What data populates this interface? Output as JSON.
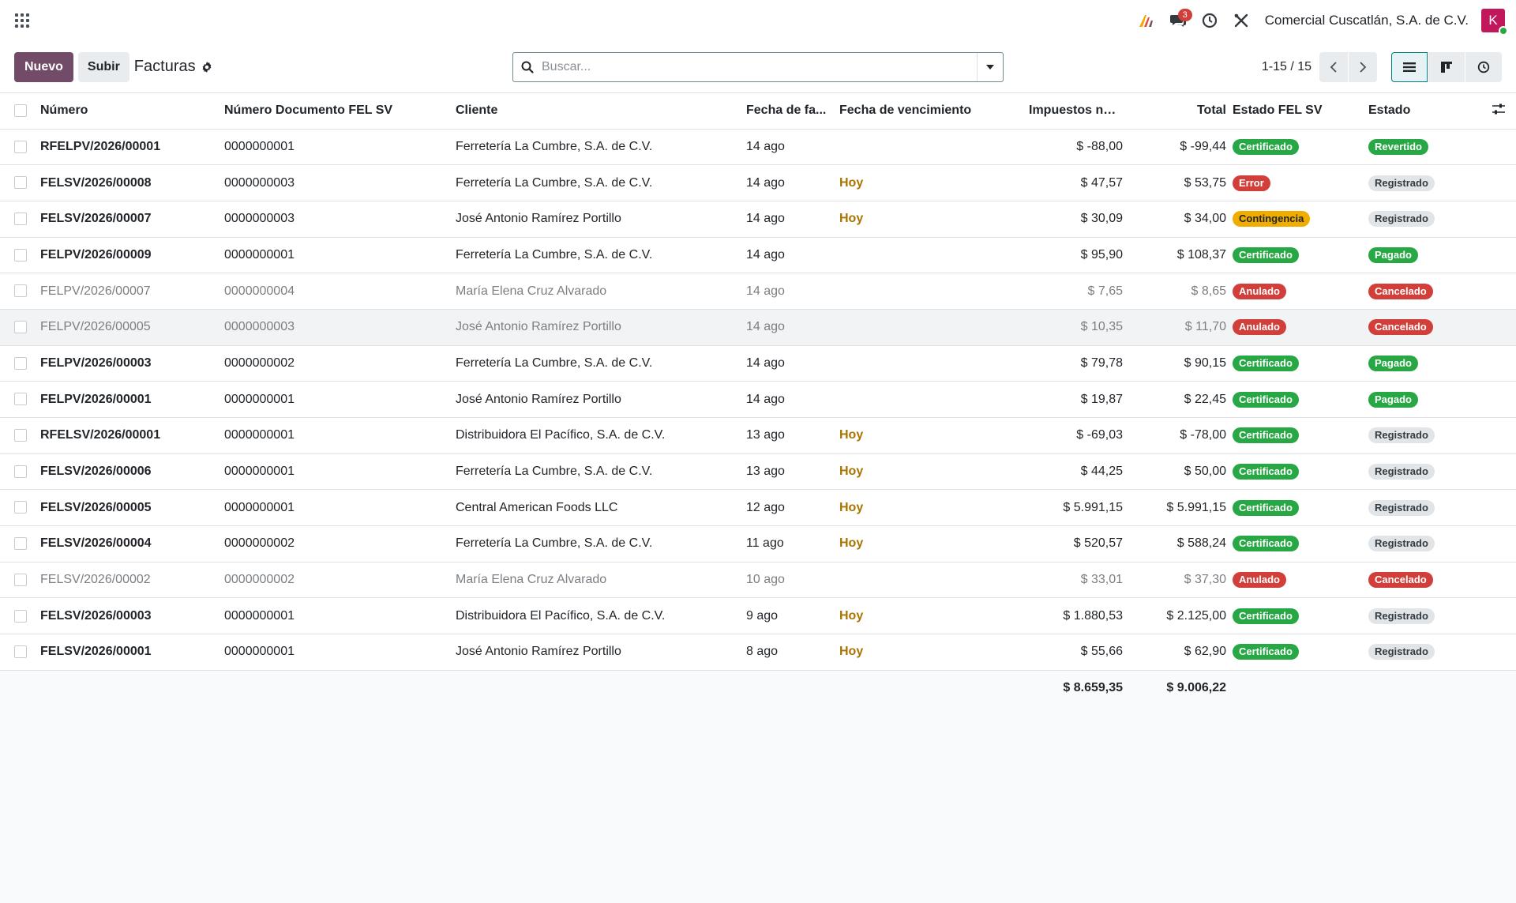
{
  "navbar": {
    "company": "Comercial Cuscatlán, S.A. de C.V.",
    "chat_count": "3",
    "avatar_letter": "K"
  },
  "control": {
    "new_label": "Nuevo",
    "upload_label": "Subir",
    "title": "Facturas",
    "search_placeholder": "Buscar...",
    "pager_value": "1-15 / 15"
  },
  "columns": {
    "numero": "Número",
    "doc_fel": "Número Documento FEL SV",
    "cliente": "Cliente",
    "fecha_factura": "Fecha de fa...",
    "fecha_vencimiento": "Fecha de vencimiento",
    "impuestos": "Impuestos no ...",
    "total": "Total",
    "estado_fel": "Estado FEL SV",
    "estado": "Estado"
  },
  "colors": {
    "brand": "#714b67",
    "accent": "#017e84",
    "badge_green": "#28a745",
    "badge_red": "#d23f3a",
    "badge_orange": "#f0ad00",
    "due_today": "#a97400"
  },
  "rows": [
    {
      "numero": "RFELPV/2026/00001",
      "doc": "0000000001",
      "cliente": "Ferretería La Cumbre, S.A. de C.V.",
      "fecha": "14 ago",
      "vence": "",
      "impuestos": "$ -88,00",
      "total": "$ -99,44",
      "fel": "Certificado",
      "fel_color": "green",
      "estado": "Revertido",
      "estado_color": "green",
      "muted": false
    },
    {
      "numero": "FELSV/2026/00008",
      "doc": "0000000003",
      "cliente": "Ferretería La Cumbre, S.A. de C.V.",
      "fecha": "14 ago",
      "vence": "Hoy",
      "impuestos": "$ 47,57",
      "total": "$ 53,75",
      "fel": "Error",
      "fel_color": "red",
      "estado": "Registrado",
      "estado_color": "grey",
      "muted": false
    },
    {
      "numero": "FELSV/2026/00007",
      "doc": "0000000003",
      "cliente": "José Antonio Ramírez Portillo",
      "fecha": "14 ago",
      "vence": "Hoy",
      "impuestos": "$ 30,09",
      "total": "$ 34,00",
      "fel": "Contingencia",
      "fel_color": "orange",
      "estado": "Registrado",
      "estado_color": "grey",
      "muted": false
    },
    {
      "numero": "FELPV/2026/00009",
      "doc": "0000000001",
      "cliente": "Ferretería La Cumbre, S.A. de C.V.",
      "fecha": "14 ago",
      "vence": "",
      "impuestos": "$ 95,90",
      "total": "$ 108,37",
      "fel": "Certificado",
      "fel_color": "green",
      "estado": "Pagado",
      "estado_color": "green",
      "muted": false
    },
    {
      "numero": "FELPV/2026/00007",
      "doc": "0000000004",
      "cliente": "María Elena Cruz Alvarado",
      "fecha": "14 ago",
      "vence": "",
      "impuestos": "$ 7,65",
      "total": "$ 8,65",
      "fel": "Anulado",
      "fel_color": "red",
      "estado": "Cancelado",
      "estado_color": "red",
      "muted": true
    },
    {
      "numero": "FELPV/2026/00005",
      "doc": "0000000003",
      "cliente": "José Antonio Ramírez Portillo",
      "fecha": "14 ago",
      "vence": "",
      "impuestos": "$ 10,35",
      "total": "$ 11,70",
      "fel": "Anulado",
      "fel_color": "red",
      "estado": "Cancelado",
      "estado_color": "red",
      "muted": true,
      "hover": true
    },
    {
      "numero": "FELPV/2026/00003",
      "doc": "0000000002",
      "cliente": "Ferretería La Cumbre, S.A. de C.V.",
      "fecha": "14 ago",
      "vence": "",
      "impuestos": "$ 79,78",
      "total": "$ 90,15",
      "fel": "Certificado",
      "fel_color": "green",
      "estado": "Pagado",
      "estado_color": "green",
      "muted": false
    },
    {
      "numero": "FELPV/2026/00001",
      "doc": "0000000001",
      "cliente": "José Antonio Ramírez Portillo",
      "fecha": "14 ago",
      "vence": "",
      "impuestos": "$ 19,87",
      "total": "$ 22,45",
      "fel": "Certificado",
      "fel_color": "green",
      "estado": "Pagado",
      "estado_color": "green",
      "muted": false
    },
    {
      "numero": "RFELSV/2026/00001",
      "doc": "0000000001",
      "cliente": "Distribuidora El Pacífico, S.A. de C.V.",
      "fecha": "13 ago",
      "vence": "Hoy",
      "impuestos": "$ -69,03",
      "total": "$ -78,00",
      "fel": "Certificado",
      "fel_color": "green",
      "estado": "Registrado",
      "estado_color": "grey",
      "muted": false
    },
    {
      "numero": "FELSV/2026/00006",
      "doc": "0000000001",
      "cliente": "Ferretería La Cumbre, S.A. de C.V.",
      "fecha": "13 ago",
      "vence": "Hoy",
      "impuestos": "$ 44,25",
      "total": "$ 50,00",
      "fel": "Certificado",
      "fel_color": "green",
      "estado": "Registrado",
      "estado_color": "grey",
      "muted": false
    },
    {
      "numero": "FELSV/2026/00005",
      "doc": "0000000001",
      "cliente": "Central American Foods LLC",
      "fecha": "12 ago",
      "vence": "Hoy",
      "impuestos": "$ 5.991,15",
      "total": "$ 5.991,15",
      "fel": "Certificado",
      "fel_color": "green",
      "estado": "Registrado",
      "estado_color": "grey",
      "muted": false
    },
    {
      "numero": "FELSV/2026/00004",
      "doc": "0000000002",
      "cliente": "Ferretería La Cumbre, S.A. de C.V.",
      "fecha": "11 ago",
      "vence": "Hoy",
      "impuestos": "$ 520,57",
      "total": "$ 588,24",
      "fel": "Certificado",
      "fel_color": "green",
      "estado": "Registrado",
      "estado_color": "grey",
      "muted": false
    },
    {
      "numero": "FELSV/2026/00002",
      "doc": "0000000002",
      "cliente": "María Elena Cruz Alvarado",
      "fecha": "10 ago",
      "vence": "",
      "impuestos": "$ 33,01",
      "total": "$ 37,30",
      "fel": "Anulado",
      "fel_color": "red",
      "estado": "Cancelado",
      "estado_color": "red",
      "muted": true
    },
    {
      "numero": "FELSV/2026/00003",
      "doc": "0000000001",
      "cliente": "Distribuidora El Pacífico, S.A. de C.V.",
      "fecha": "9 ago",
      "vence": "Hoy",
      "impuestos": "$ 1.880,53",
      "total": "$ 2.125,00",
      "fel": "Certificado",
      "fel_color": "green",
      "estado": "Registrado",
      "estado_color": "grey",
      "muted": false
    },
    {
      "numero": "FELSV/2026/00001",
      "doc": "0000000001",
      "cliente": "José Antonio Ramírez Portillo",
      "fecha": "8 ago",
      "vence": "Hoy",
      "impuestos": "$ 55,66",
      "total": "$ 62,90",
      "fel": "Certificado",
      "fel_color": "green",
      "estado": "Registrado",
      "estado_color": "grey",
      "muted": false
    }
  ],
  "totals": {
    "impuestos": "$ 8.659,35",
    "total": "$ 9.006,22"
  }
}
